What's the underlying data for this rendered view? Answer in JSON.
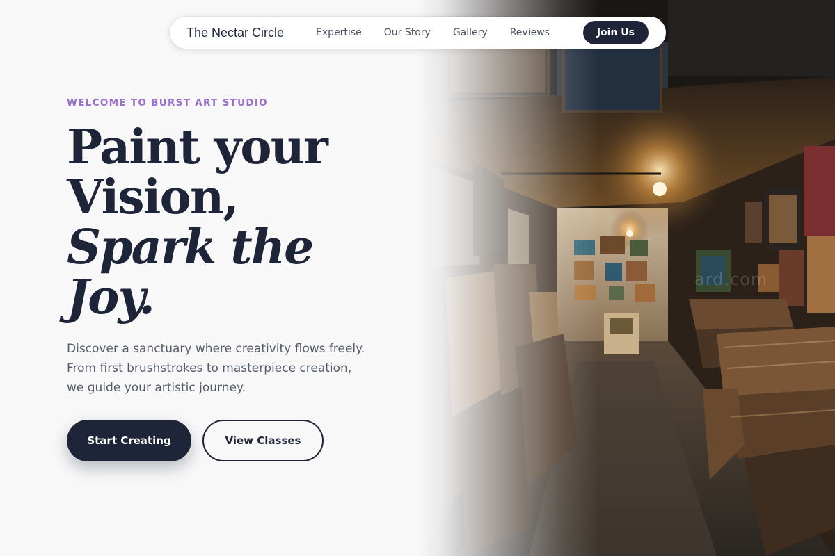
{
  "nav": {
    "brand": "The Nectar Circle",
    "links": [
      "Expertise",
      "Our Story",
      "Gallery",
      "Reviews"
    ],
    "cta": "Join Us"
  },
  "hero": {
    "eyebrow": "WELCOME TO BURST ART STUDIO",
    "headline": {
      "line1": "Paint your",
      "line2": "Vision,",
      "line3": "Spark the",
      "line4": "Joy."
    },
    "description": "Discover a sanctuary where creativity flows freely. From first brushstrokes to masterpiece creation, we guide your artistic journey.",
    "primary_button": "Start Creating",
    "secondary_button": "View Classes",
    "image_watermark": "ard.com"
  },
  "colors": {
    "navy": "#1e2538",
    "accent_purple": "#9b6fcb",
    "body_text": "#555b6a",
    "background": "#f8f8f9"
  }
}
